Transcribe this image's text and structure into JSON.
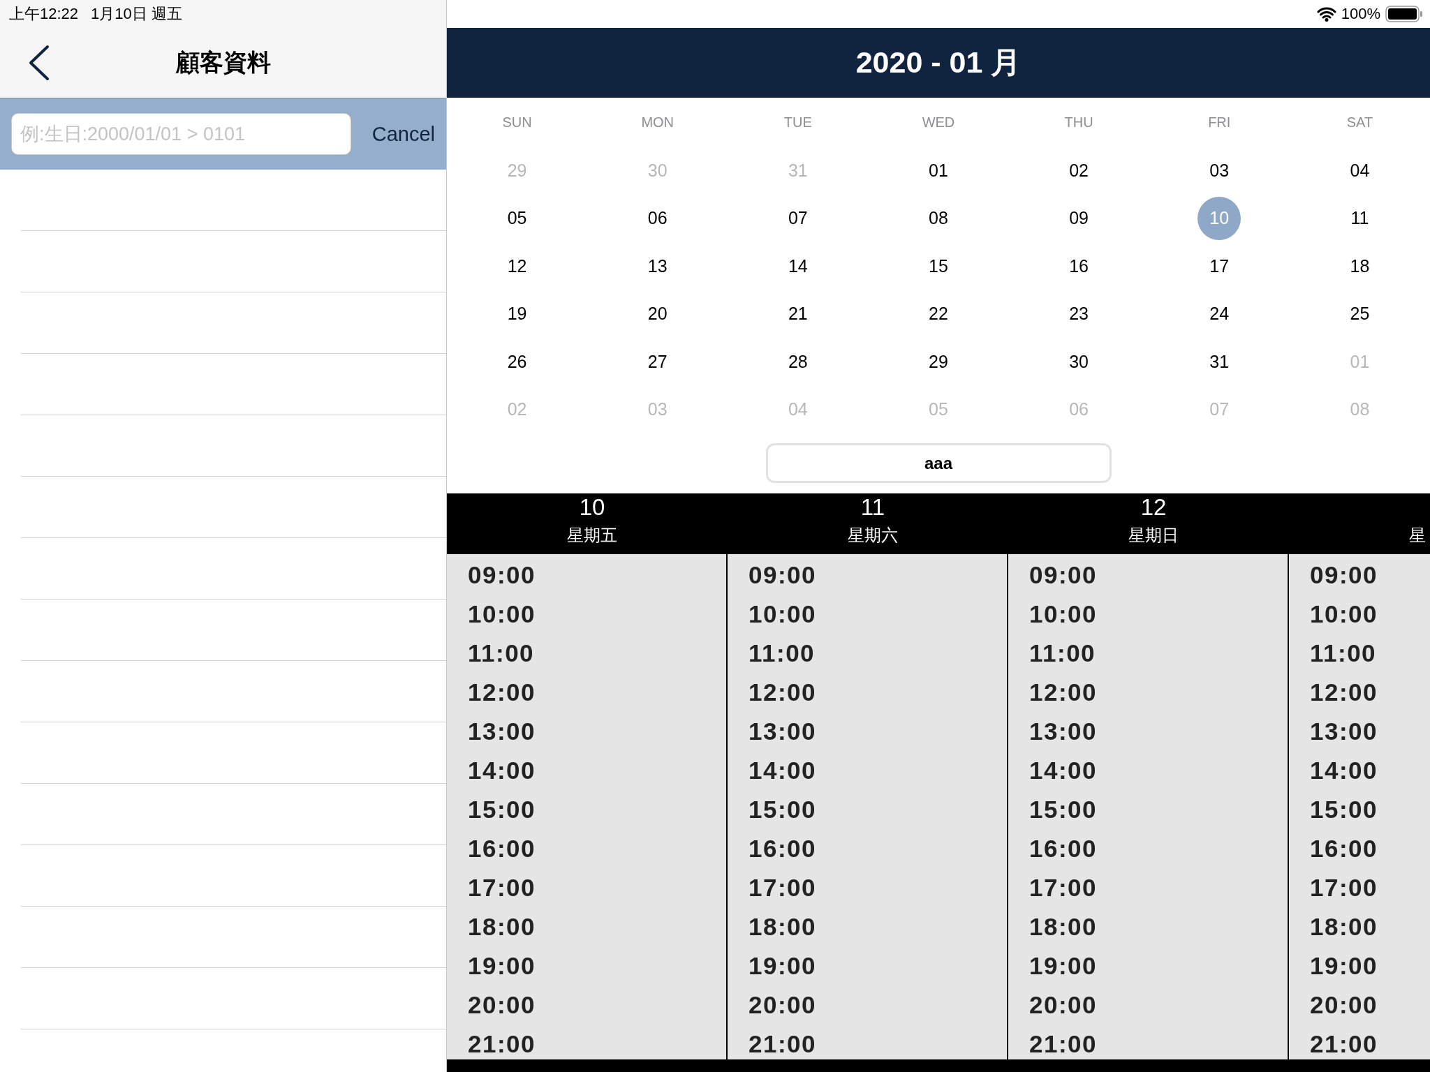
{
  "status_bar": {
    "time": "上午12:22",
    "date": "1月10日 週五",
    "battery": "100%"
  },
  "navigation": {
    "title": "顧客資料"
  },
  "search": {
    "placeholder": "例:生日:2000/01/01 > 0101",
    "cancel": "Cancel"
  },
  "calendar": {
    "title": "2020 - 01 月",
    "weekdays": [
      "SUN",
      "MON",
      "TUE",
      "WED",
      "THU",
      "FRI",
      "SAT"
    ],
    "weeks": [
      [
        {
          "day": "29",
          "in_month": false,
          "selected": false
        },
        {
          "day": "30",
          "in_month": false,
          "selected": false
        },
        {
          "day": "31",
          "in_month": false,
          "selected": false
        },
        {
          "day": "01",
          "in_month": true,
          "selected": false
        },
        {
          "day": "02",
          "in_month": true,
          "selected": false
        },
        {
          "day": "03",
          "in_month": true,
          "selected": false
        },
        {
          "day": "04",
          "in_month": true,
          "selected": false
        }
      ],
      [
        {
          "day": "05",
          "in_month": true,
          "selected": false
        },
        {
          "day": "06",
          "in_month": true,
          "selected": false
        },
        {
          "day": "07",
          "in_month": true,
          "selected": false
        },
        {
          "day": "08",
          "in_month": true,
          "selected": false
        },
        {
          "day": "09",
          "in_month": true,
          "selected": false
        },
        {
          "day": "10",
          "in_month": true,
          "selected": true
        },
        {
          "day": "11",
          "in_month": true,
          "selected": false
        }
      ],
      [
        {
          "day": "12",
          "in_month": true,
          "selected": false
        },
        {
          "day": "13",
          "in_month": true,
          "selected": false
        },
        {
          "day": "14",
          "in_month": true,
          "selected": false
        },
        {
          "day": "15",
          "in_month": true,
          "selected": false
        },
        {
          "day": "16",
          "in_month": true,
          "selected": false
        },
        {
          "day": "17",
          "in_month": true,
          "selected": false
        },
        {
          "day": "18",
          "in_month": true,
          "selected": false
        }
      ],
      [
        {
          "day": "19",
          "in_month": true,
          "selected": false
        },
        {
          "day": "20",
          "in_month": true,
          "selected": false
        },
        {
          "day": "21",
          "in_month": true,
          "selected": false
        },
        {
          "day": "22",
          "in_month": true,
          "selected": false
        },
        {
          "day": "23",
          "in_month": true,
          "selected": false
        },
        {
          "day": "24",
          "in_month": true,
          "selected": false
        },
        {
          "day": "25",
          "in_month": true,
          "selected": false
        }
      ],
      [
        {
          "day": "26",
          "in_month": true,
          "selected": false
        },
        {
          "day": "27",
          "in_month": true,
          "selected": false
        },
        {
          "day": "28",
          "in_month": true,
          "selected": false
        },
        {
          "day": "29",
          "in_month": true,
          "selected": false
        },
        {
          "day": "30",
          "in_month": true,
          "selected": false
        },
        {
          "day": "31",
          "in_month": true,
          "selected": false
        },
        {
          "day": "01",
          "in_month": false,
          "selected": false
        }
      ],
      [
        {
          "day": "02",
          "in_month": false,
          "selected": false
        },
        {
          "day": "03",
          "in_month": false,
          "selected": false
        },
        {
          "day": "04",
          "in_month": false,
          "selected": false
        },
        {
          "day": "05",
          "in_month": false,
          "selected": false
        },
        {
          "day": "06",
          "in_month": false,
          "selected": false
        },
        {
          "day": "07",
          "in_month": false,
          "selected": false
        },
        {
          "day": "08",
          "in_month": false,
          "selected": false
        }
      ]
    ]
  },
  "action_button": {
    "label": "aaa"
  },
  "schedule": {
    "days": [
      {
        "date": "10",
        "weekday": "星期五",
        "slots": [
          "09:00",
          "10:00",
          "11:00",
          "12:00",
          "13:00",
          "14:00",
          "15:00",
          "16:00",
          "17:00",
          "18:00",
          "19:00",
          "20:00",
          "21:00"
        ]
      },
      {
        "date": "11",
        "weekday": "星期六",
        "slots": [
          "09:00",
          "10:00",
          "11:00",
          "12:00",
          "13:00",
          "14:00",
          "15:00",
          "16:00",
          "17:00",
          "18:00",
          "19:00",
          "20:00",
          "21:00"
        ]
      },
      {
        "date": "12",
        "weekday": "星期日",
        "slots": [
          "09:00",
          "10:00",
          "11:00",
          "12:00",
          "13:00",
          "14:00",
          "15:00",
          "16:00",
          "17:00",
          "18:00",
          "19:00",
          "20:00",
          "21:00"
        ]
      },
      {
        "weekday": "星",
        "slots": [
          "09:00",
          "10:00",
          "11:00",
          "12:00",
          "13:00",
          "14:00",
          "15:00",
          "16:00",
          "17:00",
          "18:00",
          "19:00",
          "20:00",
          "21:00"
        ]
      }
    ]
  }
}
